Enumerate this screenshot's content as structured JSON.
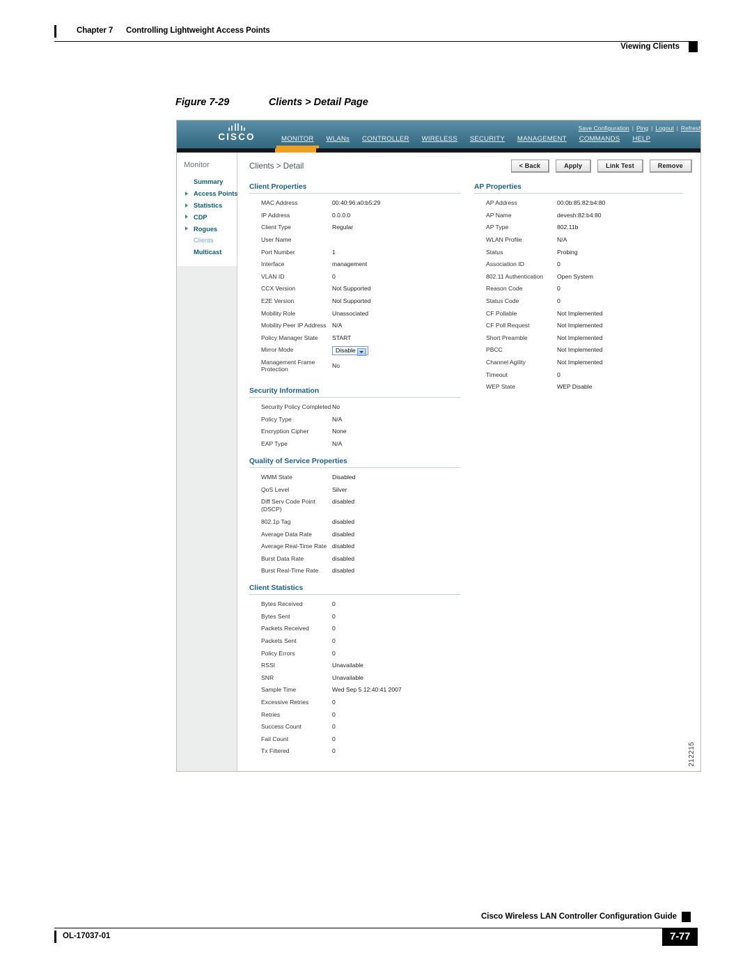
{
  "running_head": {
    "chapter": "Chapter 7",
    "chapter_title": "Controlling Lightweight Access Points",
    "section": "Viewing Clients"
  },
  "figure": {
    "number": "Figure 7-29",
    "title": "Clients > Detail Page",
    "figure_id": "212215"
  },
  "app": {
    "logo_word": "CISCO",
    "utility": {
      "save": "Save Configuration",
      "ping": "Ping",
      "logout": "Logout",
      "refresh": "Refresh"
    },
    "nav": [
      {
        "label": "MONITOR",
        "active": true
      },
      {
        "label": "WLANs",
        "active": false
      },
      {
        "label": "CONTROLLER",
        "active": false
      },
      {
        "label": "WIRELESS",
        "active": false
      },
      {
        "label": "SECURITY",
        "active": false
      },
      {
        "label": "MANAGEMENT",
        "active": false
      },
      {
        "label": "COMMANDS",
        "active": false
      },
      {
        "label": "HELP",
        "active": false
      }
    ],
    "accent_color": "#f0a01e",
    "header_color": "#4a7e96"
  },
  "sidebar": {
    "title": "Monitor",
    "items": [
      {
        "label": "Summary",
        "expandable": false,
        "current": false
      },
      {
        "label": "Access Points",
        "expandable": true,
        "current": false
      },
      {
        "label": "Statistics",
        "expandable": true,
        "current": false
      },
      {
        "label": "CDP",
        "expandable": true,
        "current": false
      },
      {
        "label": "Rogues",
        "expandable": true,
        "current": false
      },
      {
        "label": "Clients",
        "expandable": false,
        "current": true
      },
      {
        "label": "Multicast",
        "expandable": false,
        "current": false
      }
    ]
  },
  "main": {
    "breadcrumb": "Clients > Detail",
    "buttons": [
      {
        "label": "< Back"
      },
      {
        "label": "Apply"
      },
      {
        "label": "Link Test"
      },
      {
        "label": "Remove"
      }
    ],
    "client_properties": {
      "heading": "Client Properties",
      "rows": [
        {
          "key": "MAC Address",
          "value": "00:40:96:a0:b5:29"
        },
        {
          "key": "IP Address",
          "value": "0.0.0.0"
        },
        {
          "key": "Client Type",
          "value": "Regular"
        },
        {
          "key": "User Name",
          "value": ""
        },
        {
          "key": "Port Number",
          "value": "1"
        },
        {
          "key": "Interface",
          "value": "management"
        },
        {
          "key": "VLAN ID",
          "value": "0"
        },
        {
          "key": "CCX Version",
          "value": "Not Supported"
        },
        {
          "key": "E2E Version",
          "value": "Not Supported"
        },
        {
          "key": "Mobility Role",
          "value": "Unassociated"
        },
        {
          "key": "Mobility Peer IP Address",
          "value": "N/A"
        },
        {
          "key": "Policy Manager State",
          "value": "START"
        }
      ],
      "mirror_mode": {
        "key": "Mirror Mode",
        "value": "Disable"
      },
      "mfp": {
        "key": "Management Frame Protection",
        "key_line1": "Management Frame",
        "key_line2": "Protection",
        "value": "No"
      }
    },
    "ap_properties": {
      "heading": "AP Properties",
      "rows": [
        {
          "key": "AP Address",
          "value": "00:0b:85:82:b4:80"
        },
        {
          "key": "AP Name",
          "value": "devesh:82:b4:80"
        },
        {
          "key": "AP Type",
          "value": "802.11b"
        },
        {
          "key": "WLAN Profile",
          "value": "N/A"
        },
        {
          "key": "Status",
          "value": "Probing"
        },
        {
          "key": "Association ID",
          "value": "0"
        },
        {
          "key": "802.11 Authentication",
          "value": "Open System"
        },
        {
          "key": "Reason Code",
          "value": "0"
        },
        {
          "key": "Status Code",
          "value": "0"
        },
        {
          "key": "CF Pollable",
          "value": "Not Implemented"
        },
        {
          "key": "CF Poll Request",
          "value": "Not Implemented"
        },
        {
          "key": "Short Preamble",
          "value": "Not Implemented"
        },
        {
          "key": "PBCC",
          "value": "Not Implemented"
        },
        {
          "key": "Channel Agility",
          "value": "Not Implemented"
        },
        {
          "key": "Timeout",
          "value": "0"
        },
        {
          "key": "WEP State",
          "value": "WEP Disable"
        }
      ]
    },
    "security_information": {
      "heading": "Security Information",
      "rows": [
        {
          "key": "Security Policy Completed",
          "value": "No"
        },
        {
          "key": "Policy Type",
          "value": "N/A"
        },
        {
          "key": "Encryption Cipher",
          "value": "None"
        },
        {
          "key": "EAP Type",
          "value": "N/A"
        }
      ]
    },
    "qos_properties": {
      "heading": "Quality of Service Properties",
      "rows": [
        {
          "key": "WMM State",
          "value": "Disabled"
        },
        {
          "key": "QoS Level",
          "value": "Silver"
        },
        {
          "key": "Diff Serv Code Point (DSCP)",
          "value": "disabled"
        },
        {
          "key": "802.1p Tag",
          "value": "disabled"
        },
        {
          "key": "Average Data Rate",
          "value": "disabled"
        },
        {
          "key": "Average Real-Time Rate",
          "value": "disabled"
        },
        {
          "key": "Burst Data Rate",
          "value": "disabled"
        },
        {
          "key": "Burst Real-Time Rate",
          "value": "disabled"
        }
      ]
    },
    "client_statistics": {
      "heading": "Client Statistics",
      "rows": [
        {
          "key": "Bytes Received",
          "value": "0"
        },
        {
          "key": "Bytes Sent",
          "value": "0"
        },
        {
          "key": "Packets Received",
          "value": "0"
        },
        {
          "key": "Packets Sent",
          "value": "0"
        },
        {
          "key": "Policy Errors",
          "value": "0"
        },
        {
          "key": "RSSI",
          "value": "Unavailable"
        },
        {
          "key": "SNR",
          "value": "Unavailable"
        },
        {
          "key": "Sample Time",
          "value": "Wed Sep  5 12:40:41 2007"
        },
        {
          "key": "Excessive Retries",
          "value": "0"
        },
        {
          "key": "Retries",
          "value": "0"
        },
        {
          "key": "Success Count",
          "value": "0"
        },
        {
          "key": "Fail Count",
          "value": "0"
        },
        {
          "key": "Tx Filtered",
          "value": "0"
        }
      ]
    }
  },
  "footer": {
    "guide_title": "Cisco Wireless LAN Controller Configuration Guide",
    "doc_id": "OL-17037-01",
    "page": "7-77"
  }
}
